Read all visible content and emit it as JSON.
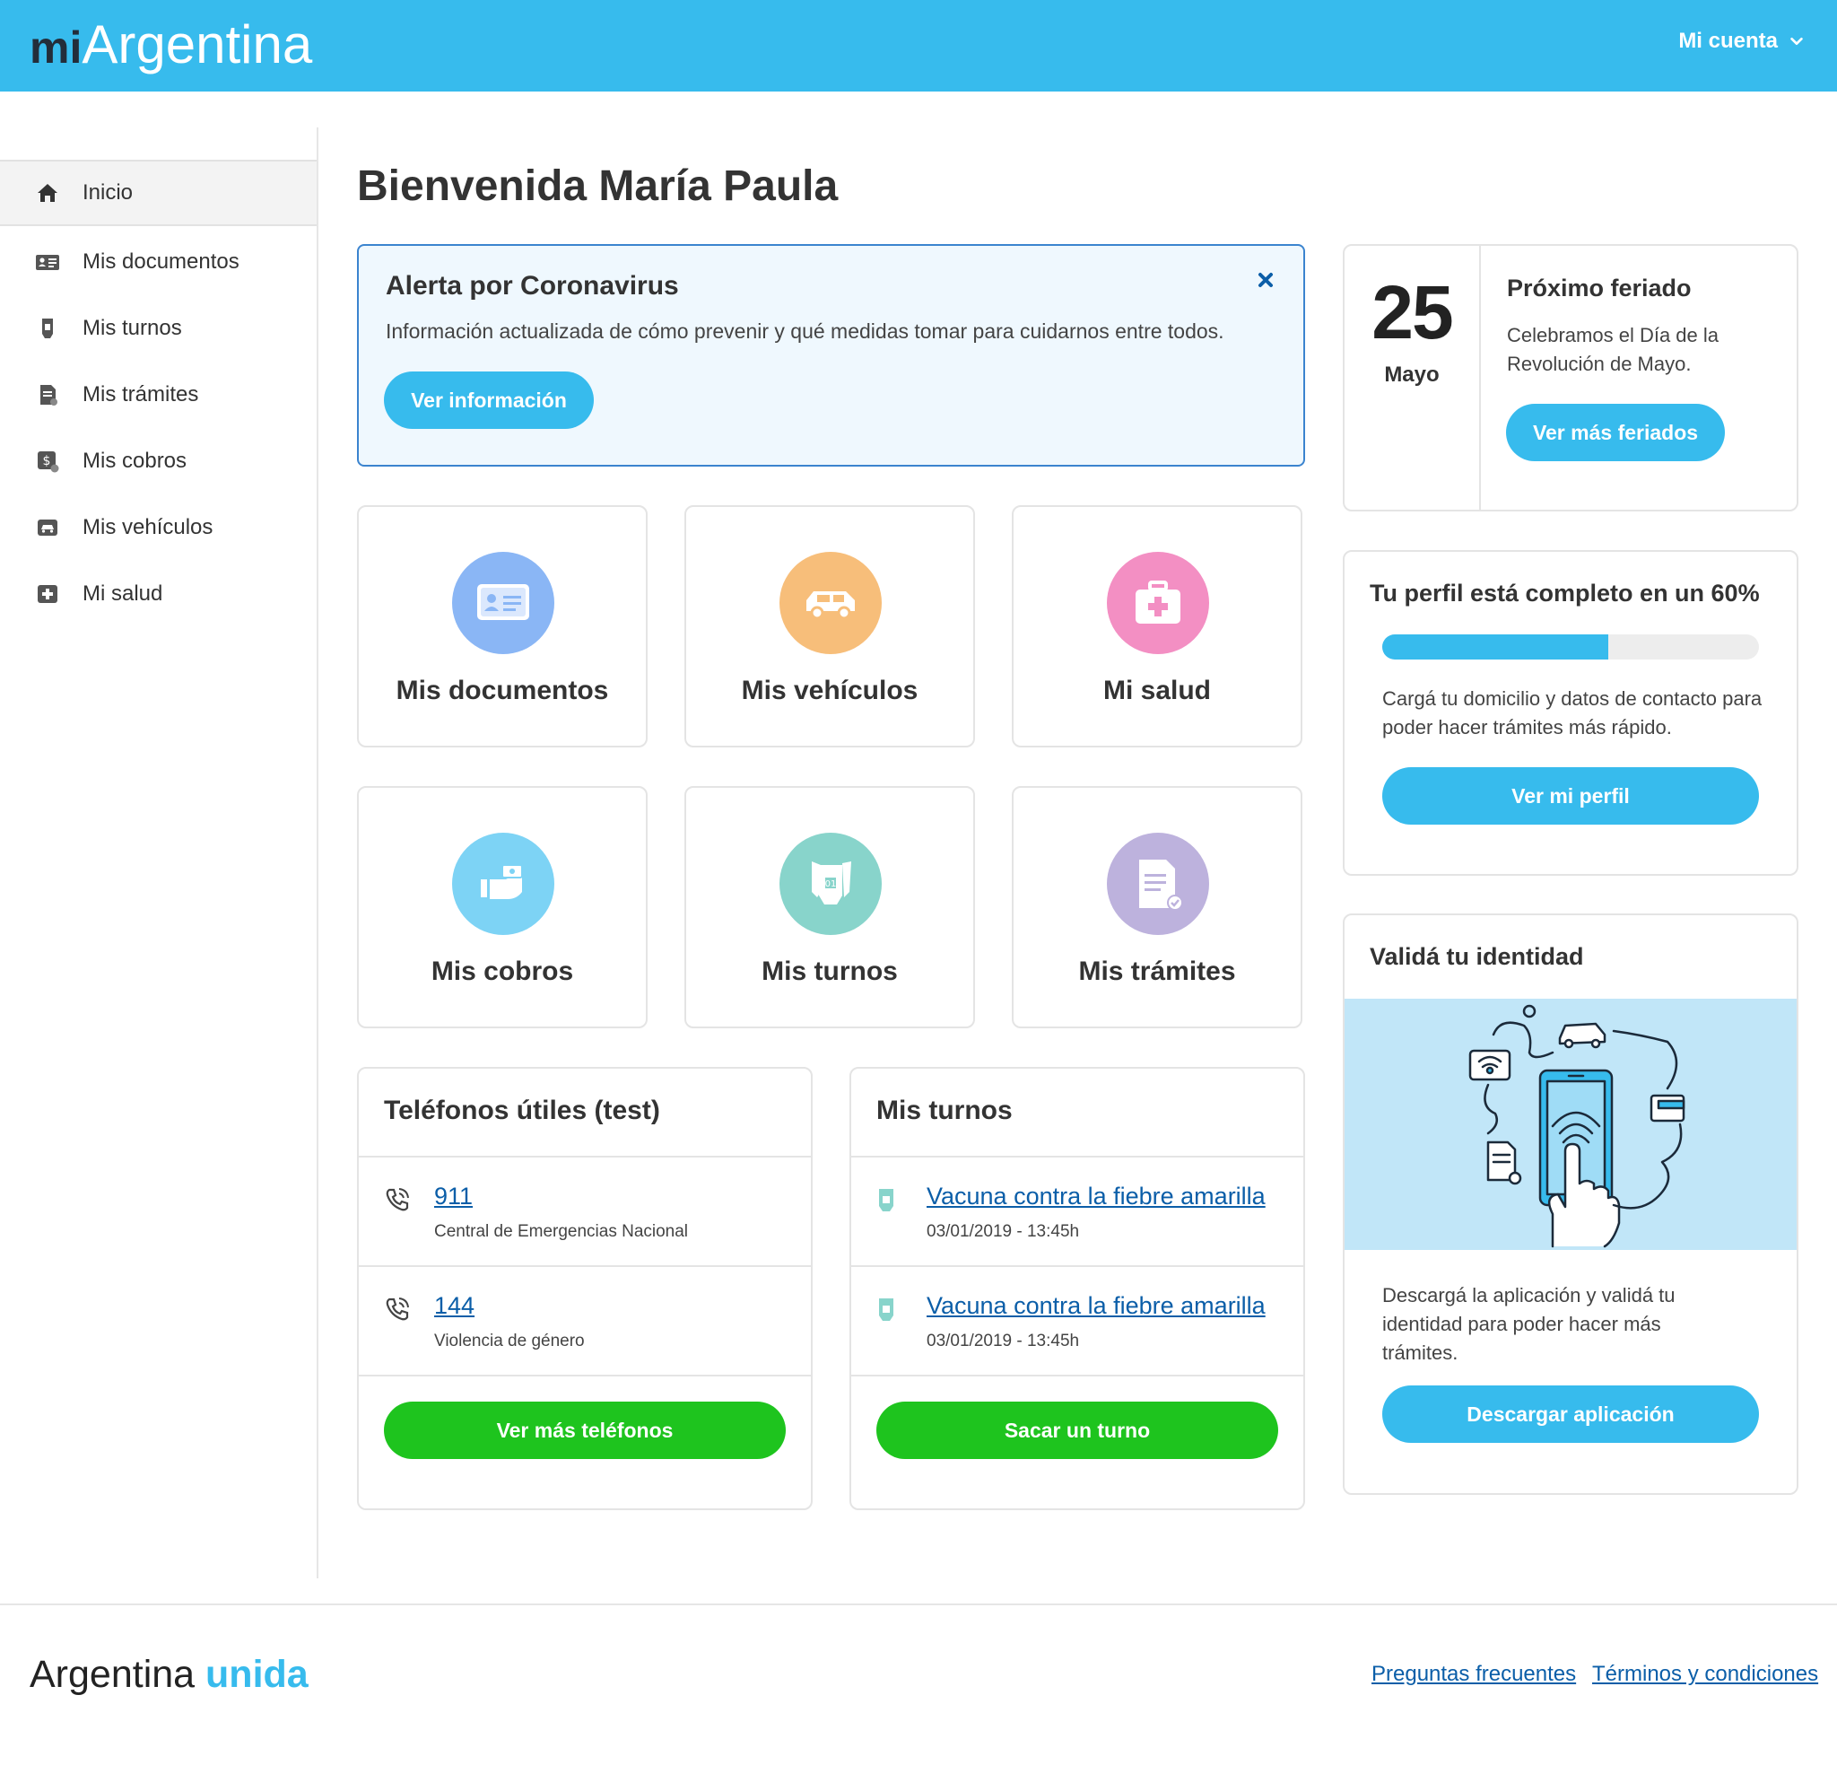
{
  "header": {
    "logo_mi": "mi",
    "logo_name": "Argentina",
    "account_label": "Mi cuenta"
  },
  "sidebar": {
    "items": [
      {
        "label": "Inicio",
        "icon": "home-icon"
      },
      {
        "label": "Mis documentos",
        "icon": "id-card-icon"
      },
      {
        "label": "Mis turnos",
        "icon": "turn-ticket-icon"
      },
      {
        "label": "Mis trámites",
        "icon": "document-icon"
      },
      {
        "label": "Mis cobros",
        "icon": "payment-icon"
      },
      {
        "label": "Mis vehículos",
        "icon": "car-icon"
      },
      {
        "label": "Mi salud",
        "icon": "health-icon"
      }
    ]
  },
  "main": {
    "title": "Bienvenida María Paula",
    "alert": {
      "title": "Alerta por Coronavirus",
      "text": "Información actualizada de cómo prevenir y qué medidas tomar para cuidarnos entre todos.",
      "button": "Ver información"
    },
    "tiles": [
      {
        "label": "Mis documentos",
        "color": "#8ab6f5"
      },
      {
        "label": "Mis vehículos",
        "color": "#f7be7a"
      },
      {
        "label": "Mi salud",
        "color": "#f38fc3"
      },
      {
        "label": "Mis cobros",
        "color": "#7dd3f5"
      },
      {
        "label": "Mis turnos",
        "color": "#88d4cb"
      },
      {
        "label": "Mis trámites",
        "color": "#bdb2dd"
      }
    ],
    "phones": {
      "title": "Teléfonos útiles (test)",
      "items": [
        {
          "number": "911",
          "desc": "Central de Emergencias Nacional"
        },
        {
          "number": "144",
          "desc": "Violencia de género"
        }
      ],
      "button": "Ver más teléfonos"
    },
    "turns": {
      "title": "Mis turnos",
      "items": [
        {
          "name": "Vacuna contra la fiebre amarilla",
          "date": "03/01/2019 - 13:45h"
        },
        {
          "name": "Vacuna contra la fiebre amarilla",
          "date": "03/01/2019 - 13:45h"
        }
      ],
      "button": "Sacar un turno"
    }
  },
  "right": {
    "holiday": {
      "day": "25",
      "month": "Mayo",
      "title": "Próximo feriado",
      "text": "Celebramos el Día de la Revolución de Mayo.",
      "button": "Ver más feriados"
    },
    "profile": {
      "title": "Tu perfil está completo en un 60%",
      "progress": 0.6,
      "text": "Cargá tu domicilio y datos de contacto para poder hacer trámites más rápido.",
      "button": "Ver mi perfil"
    },
    "identity": {
      "title": "Validá tu identidad",
      "text": "Descargá la aplicación y validá tu identidad para poder hacer más trámites.",
      "button": "Descargar aplicación"
    }
  },
  "footer": {
    "logo_a": "Argentina",
    "logo_b": "unida",
    "link_faq": "Preguntas frecuentes",
    "link_terms": "Términos y condiciones"
  },
  "colors": {
    "brand": "#37bbed",
    "green": "#1ec41e",
    "link": "#0b5ea8"
  }
}
